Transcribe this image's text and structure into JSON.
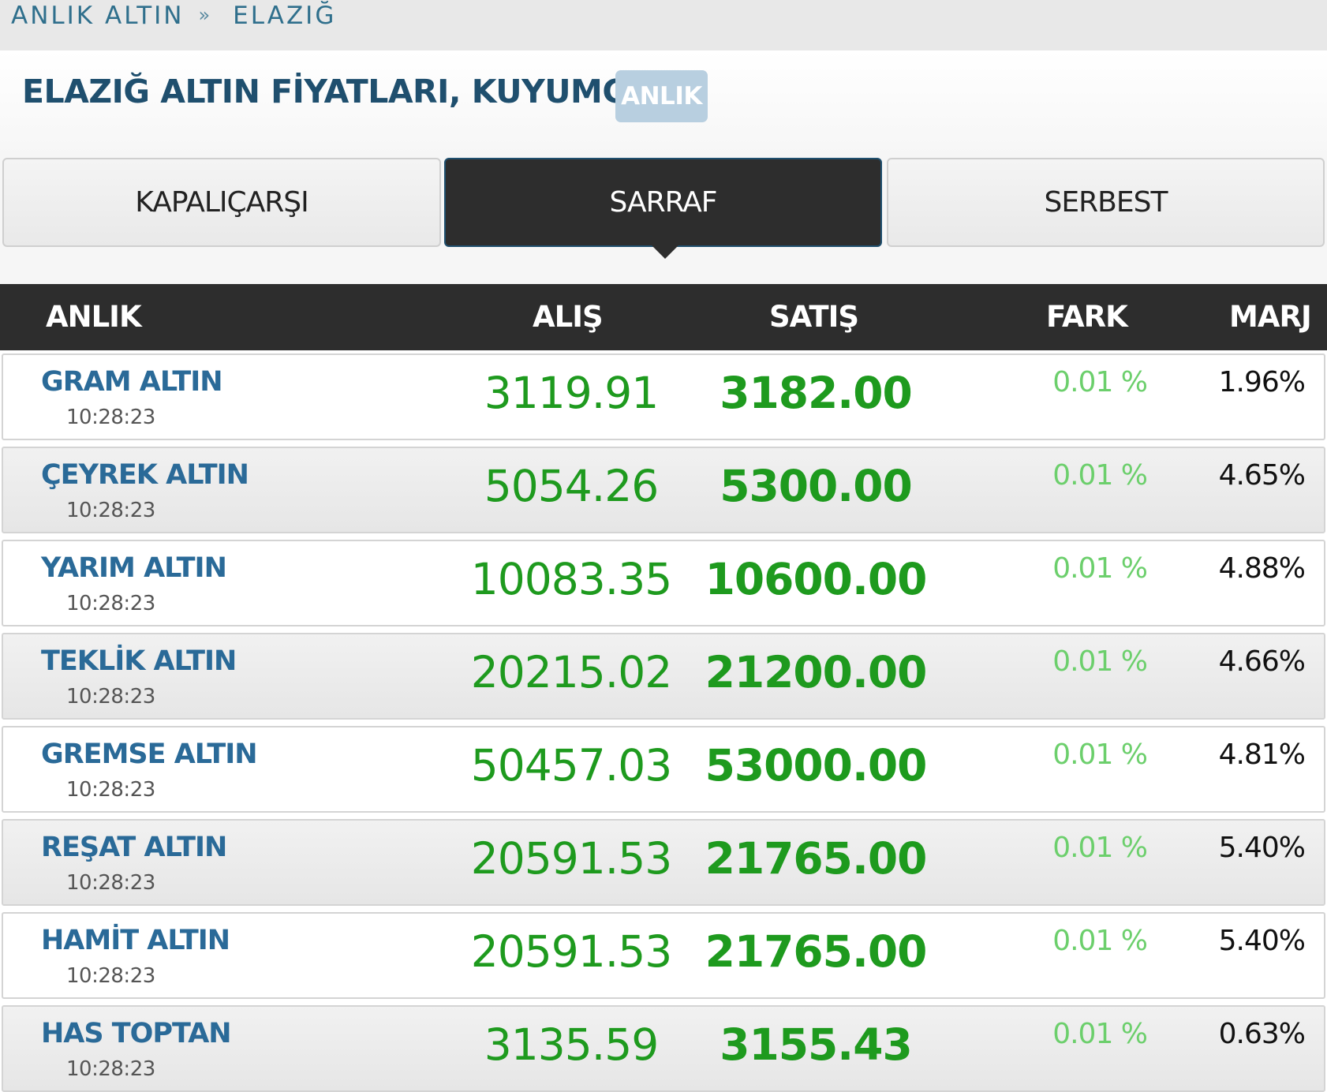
{
  "breadcrumb": {
    "root": "ANLIK ALTIN",
    "separator": "»",
    "current": "ELAZIĞ"
  },
  "header": {
    "title": "ELAZIĞ ALTIN FİYATLARI, KUYUMCU",
    "badge": "ANLIK"
  },
  "tabs": [
    {
      "label": "KAPALIÇARŞI",
      "active": false
    },
    {
      "label": "SARRAF",
      "active": true
    },
    {
      "label": "SERBEST",
      "active": false
    }
  ],
  "table": {
    "columns": {
      "name": "ANLIK",
      "buy": "ALIŞ",
      "sell": "SATIŞ",
      "diff": "FARK",
      "margin": "MARJ"
    },
    "rows": [
      {
        "name": "GRAM ALTIN",
        "time": "10:28:23",
        "buy": "3119.91",
        "sell": "3182.00",
        "diff": "0.01 %",
        "margin": "1.96%"
      },
      {
        "name": "ÇEYREK ALTIN",
        "time": "10:28:23",
        "buy": "5054.26",
        "sell": "5300.00",
        "diff": "0.01 %",
        "margin": "4.65%"
      },
      {
        "name": "YARIM ALTIN",
        "time": "10:28:23",
        "buy": "10083.35",
        "sell": "10600.00",
        "diff": "0.01 %",
        "margin": "4.88%"
      },
      {
        "name": "TEKLİK ALTIN",
        "time": "10:28:23",
        "buy": "20215.02",
        "sell": "21200.00",
        "diff": "0.01 %",
        "margin": "4.66%"
      },
      {
        "name": "GREMSE ALTIN",
        "time": "10:28:23",
        "buy": "50457.03",
        "sell": "53000.00",
        "diff": "0.01 %",
        "margin": "4.81%"
      },
      {
        "name": "REŞAT ALTIN",
        "time": "10:28:23",
        "buy": "20591.53",
        "sell": "21765.00",
        "diff": "0.01 %",
        "margin": "5.40%"
      },
      {
        "name": "HAMİT ALTIN",
        "time": "10:28:23",
        "buy": "20591.53",
        "sell": "21765.00",
        "diff": "0.01 %",
        "margin": "5.40%"
      },
      {
        "name": "HAS TOPTAN",
        "time": "10:28:23",
        "buy": "3135.59",
        "sell": "3155.43",
        "diff": "0.01 %",
        "margin": "0.63%"
      }
    ]
  },
  "colors": {
    "link": "#2a6a98",
    "title": "#1f4f6e",
    "price_green": "#1e9a1e",
    "diff_green": "#6ccf6c",
    "header_dark": "#2d2d2d",
    "badge": "#b8cfe0"
  }
}
